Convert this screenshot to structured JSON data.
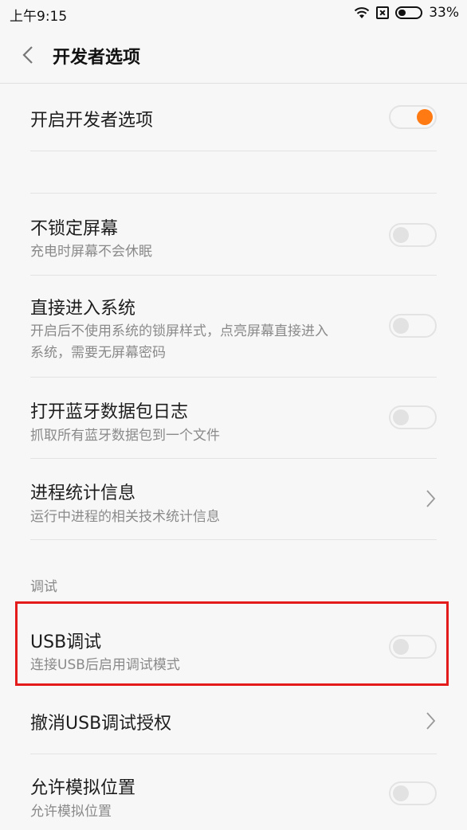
{
  "status_bar": {
    "time": "上午9:15",
    "battery_percent": "33%",
    "battery_level": 0.33,
    "icons": [
      "wifi-icon",
      "no-sim-icon",
      "battery-icon"
    ]
  },
  "header": {
    "back_icon": "chevron-left-icon",
    "title": "开发者选项"
  },
  "colors": {
    "accent": "#ff7a12",
    "highlight": "#e31b1b"
  },
  "settings": [
    {
      "title": "开启开发者选项",
      "subtitle": "",
      "control": "toggle",
      "on": true
    },
    {
      "title": "不锁定屏幕",
      "subtitle": "充电时屏幕不会休眠",
      "control": "toggle",
      "on": false
    },
    {
      "title": "直接进入系统",
      "subtitle_line1": "开启后不使用系统的锁屏样式，点亮屏幕直接进入",
      "subtitle_line2": "系统，需要无屏幕密码",
      "control": "toggle",
      "on": false
    },
    {
      "title": "打开蓝牙数据包日志",
      "subtitle": "抓取所有蓝牙数据包到一个文件",
      "control": "toggle",
      "on": false
    },
    {
      "title": "进程统计信息",
      "subtitle": "运行中进程的相关技术统计信息",
      "control": "chevron"
    }
  ],
  "debug_section": {
    "label": "调试",
    "items": [
      {
        "title": "USB调试",
        "subtitle": "连接USB后启用调试模式",
        "control": "toggle",
        "on": false
      },
      {
        "title": "撤消USB调试授权",
        "subtitle": "",
        "control": "chevron"
      },
      {
        "title": "允许模拟位置",
        "subtitle": "允许模拟位置",
        "control": "toggle",
        "on": false
      }
    ]
  }
}
